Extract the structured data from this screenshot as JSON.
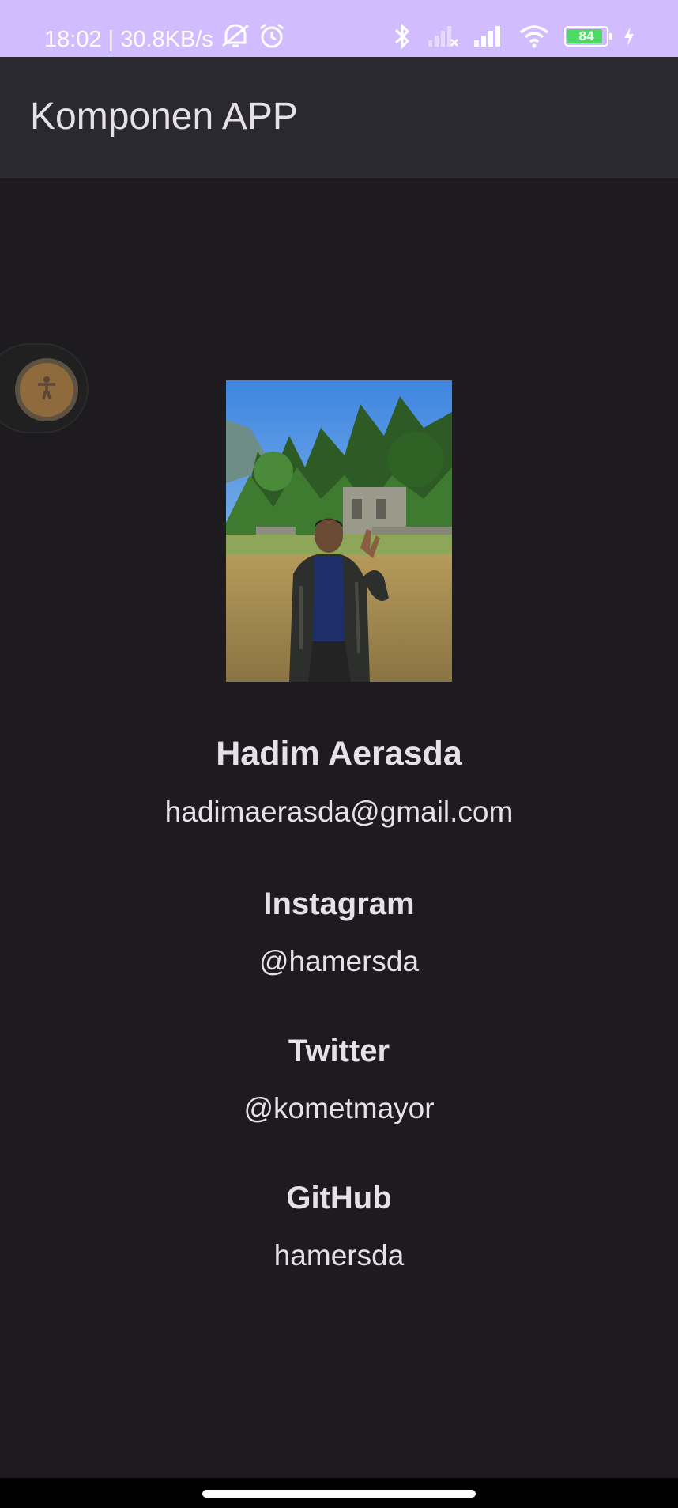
{
  "status_bar": {
    "time_speed": "18:02 | 30.8KB/s",
    "battery_level": "84",
    "icons": [
      "mute-icon",
      "alarm-icon",
      "bluetooth-icon",
      "signal-icon",
      "signal-icon",
      "wifi-icon",
      "battery-icon",
      "charging-icon"
    ],
    "background_color": "#d0bcff"
  },
  "app_bar": {
    "title": "Komponen APP"
  },
  "floating_button": {
    "icon": "accessibility-icon"
  },
  "profile": {
    "name": "Hadim Aerasda",
    "email": "hadimaerasda@gmail.com"
  },
  "social": [
    {
      "label": "Instagram",
      "value": "@hamersda"
    },
    {
      "label": "Twitter",
      "value": "@kometmayor"
    },
    {
      "label": "GitHub",
      "value": "hamersda"
    }
  ]
}
